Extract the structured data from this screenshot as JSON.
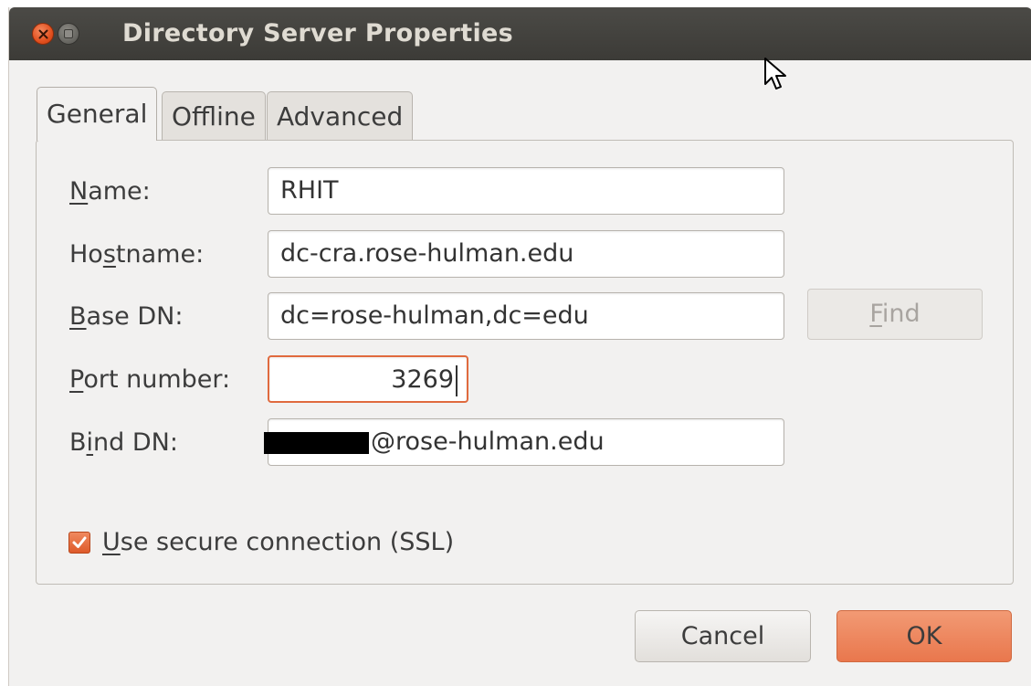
{
  "window": {
    "title": "Directory Server Properties"
  },
  "tabs": [
    {
      "label": "General",
      "active": true
    },
    {
      "label": "Offline",
      "active": false
    },
    {
      "label": "Advanced",
      "active": false
    }
  ],
  "general": {
    "name": {
      "label_mnemonic": "N",
      "label_rest": "ame:",
      "value": "RHIT"
    },
    "hostname": {
      "label_pre": "Ho",
      "label_mnemonic": "s",
      "label_rest": "tname:",
      "value": "dc-cra.rose-hulman.edu"
    },
    "base_dn": {
      "label_mnemonic": "B",
      "label_rest": "ase DN:",
      "value": "dc=rose-hulman,dc=edu"
    },
    "find_button": {
      "label_mnemonic": "F",
      "label_rest": "ind",
      "enabled": false
    },
    "port": {
      "label_mnemonic": "P",
      "label_rest": "ort number:",
      "value": "3269"
    },
    "bind_dn": {
      "label_pre": "B",
      "label_mnemonic": "i",
      "label_rest": "nd DN:",
      "value": "@rose-hulman.edu"
    },
    "ssl": {
      "label_mnemonic": "U",
      "label_rest": "se secure connection (SSL)",
      "checked": true
    }
  },
  "buttons": {
    "cancel": "Cancel",
    "ok": "OK"
  },
  "colors": {
    "accent": "#e9774d",
    "titlebar": "#3c3b37",
    "background": "#f2f1f0"
  }
}
